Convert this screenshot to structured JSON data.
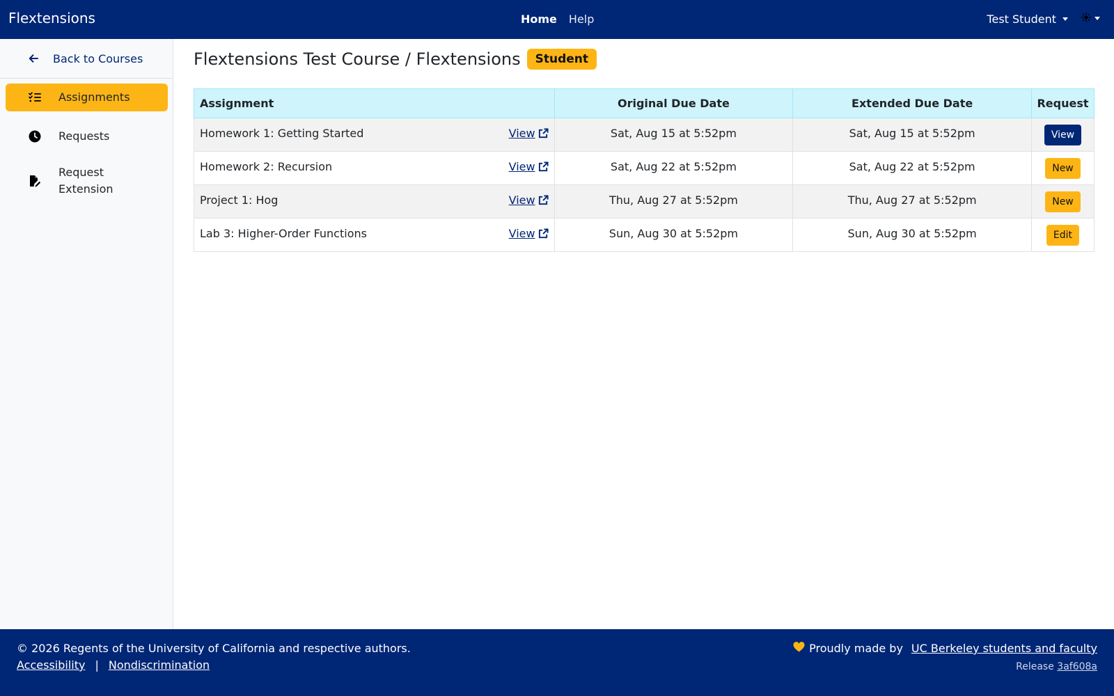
{
  "navbar": {
    "brand": "Flextensions",
    "links": [
      "Home",
      "Help"
    ],
    "user": "Test Student",
    "theme_icon": "sun-icon"
  },
  "sidebar": {
    "back": "Back to Courses",
    "items": [
      {
        "label": "Assignments",
        "icon": "list-check-icon",
        "active": true
      },
      {
        "label": "Requests",
        "icon": "clock-icon",
        "active": false
      },
      {
        "label": "Request Extension",
        "icon": "file-pen-icon",
        "active": false
      }
    ]
  },
  "page": {
    "title": "Flextensions Test Course / Flextensions",
    "role_badge": "Student"
  },
  "table": {
    "headers": [
      "Assignment",
      "Original Due Date",
      "Extended Due Date",
      "Request"
    ],
    "link_label": "View",
    "rows": [
      {
        "name": "Homework 1: Getting Started",
        "original": "Sat, Aug 15 at 5:52pm",
        "extended": "Sat, Aug 15 at 5:52pm",
        "action": "View"
      },
      {
        "name": "Homework 2: Recursion",
        "original": "Sat, Aug 22 at 5:52pm",
        "extended": "Sat, Aug 22 at 5:52pm",
        "action": "New"
      },
      {
        "name": "Project 1: Hog",
        "original": "Thu, Aug 27 at 5:52pm",
        "extended": "Thu, Aug 27 at 5:52pm",
        "action": "New"
      },
      {
        "name": "Lab 3: Higher-Order Functions",
        "original": "Sun, Aug 30 at 5:52pm",
        "extended": "Sun, Aug 30 at 5:52pm",
        "action": "Edit"
      }
    ]
  },
  "footer": {
    "copyright": "© 2026 Regents of the University of California and respective authors.",
    "accessibility": "Accessibility",
    "separator": "|",
    "nondiscrimination": "Nondiscrimination",
    "made_prefix": "Proudly made by",
    "made_link": "UC Berkeley students and faculty",
    "release_label": "Release",
    "release_hash": "3af608a"
  },
  "colors": {
    "primary": "#002676",
    "accent": "#FDB515",
    "table_header": "#cff4fc"
  }
}
